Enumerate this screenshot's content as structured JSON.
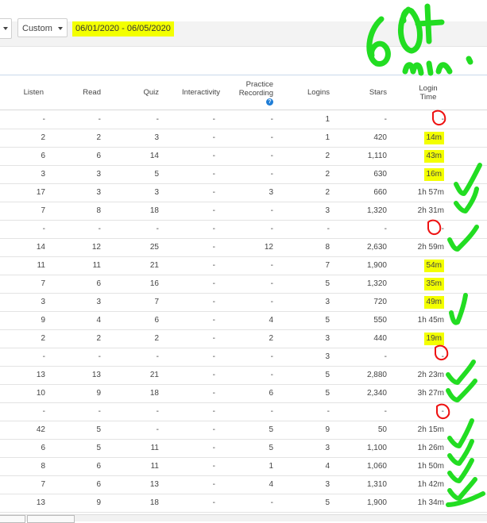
{
  "toolbar": {
    "custom_label": "Custom",
    "date_range": "06/01/2020 - 06/05/2020"
  },
  "table": {
    "headers": {
      "listen": "Listen",
      "read": "Read",
      "quiz": "Quiz",
      "interactivity": "Interactivity",
      "practice_recording_1": "Practice",
      "practice_recording_2": "Recording",
      "logins": "Logins",
      "stars": "Stars",
      "login_time_1": "Login",
      "login_time_2": "Time"
    },
    "rows": [
      [
        "-",
        "-",
        "-",
        "-",
        "-",
        "1",
        "-",
        "-"
      ],
      [
        "2",
        "2",
        "3",
        "-",
        "-",
        "1",
        "420",
        "14m"
      ],
      [
        "6",
        "6",
        "14",
        "-",
        "-",
        "2",
        "1,110",
        "43m"
      ],
      [
        "3",
        "3",
        "5",
        "-",
        "-",
        "2",
        "630",
        "16m"
      ],
      [
        "17",
        "3",
        "3",
        "-",
        "3",
        "2",
        "660",
        "1h 57m"
      ],
      [
        "7",
        "8",
        "18",
        "-",
        "-",
        "3",
        "1,320",
        "2h 31m"
      ],
      [
        "-",
        "-",
        "-",
        "-",
        "-",
        "-",
        "-",
        "-"
      ],
      [
        "14",
        "12",
        "25",
        "-",
        "12",
        "8",
        "2,630",
        "2h 59m"
      ],
      [
        "11",
        "11",
        "21",
        "-",
        "-",
        "7",
        "1,900",
        "54m"
      ],
      [
        "7",
        "6",
        "16",
        "-",
        "-",
        "5",
        "1,320",
        "35m"
      ],
      [
        "3",
        "3",
        "7",
        "-",
        "-",
        "3",
        "720",
        "49m"
      ],
      [
        "9",
        "4",
        "6",
        "-",
        "4",
        "5",
        "550",
        "1h 45m"
      ],
      [
        "2",
        "2",
        "2",
        "-",
        "2",
        "3",
        "440",
        "19m"
      ],
      [
        "-",
        "-",
        "-",
        "-",
        "-",
        "3",
        "-",
        "-"
      ],
      [
        "13",
        "13",
        "21",
        "-",
        "-",
        "5",
        "2,880",
        "2h 23m"
      ],
      [
        "10",
        "9",
        "18",
        "-",
        "6",
        "5",
        "2,340",
        "3h 27m"
      ],
      [
        "-",
        "-",
        "-",
        "-",
        "-",
        "-",
        "-",
        "-"
      ],
      [
        "42",
        "5",
        "-",
        "-",
        "5",
        "9",
        "50",
        "2h 15m"
      ],
      [
        "6",
        "5",
        "11",
        "-",
        "5",
        "3",
        "1,100",
        "1h 26m"
      ],
      [
        "8",
        "6",
        "11",
        "-",
        "1",
        "4",
        "1,060",
        "1h 50m"
      ],
      [
        "7",
        "6",
        "13",
        "-",
        "4",
        "3",
        "1,310",
        "1h 42m"
      ],
      [
        "13",
        "9",
        "18",
        "-",
        "-",
        "5",
        "1,900",
        "1h 34m"
      ]
    ],
    "highlighted_time_rows": [
      1,
      2,
      3,
      8,
      9,
      10,
      12
    ]
  },
  "annotation": {
    "handwritten_note": "60+ min.",
    "marker_color": "#22dd22",
    "circle_color": "#ee1111",
    "highlight_color": "#f3ff00"
  }
}
